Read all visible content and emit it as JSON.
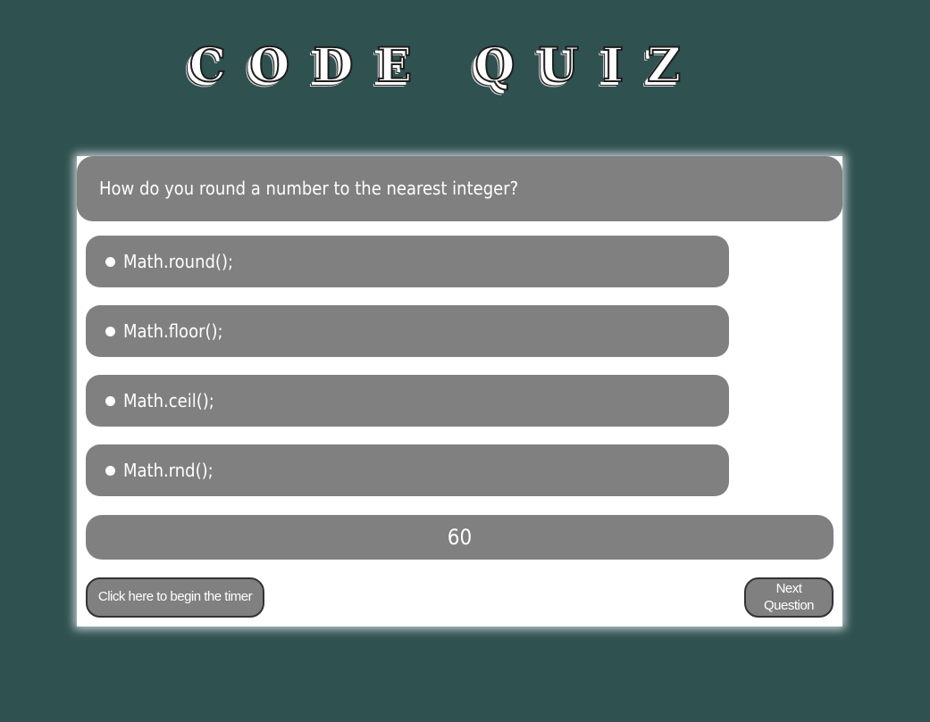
{
  "header": {
    "title": "CODE QUIZ"
  },
  "quiz": {
    "question": "How do you round a number to the nearest integer?",
    "answers": [
      "Math.round();",
      "Math.floor();",
      "Math.ceil();",
      "Math.rnd();"
    ],
    "timer_value": "60",
    "start_button_label": "Click here to begin the timer",
    "next_button_label": "Next Question"
  },
  "colors": {
    "background": "#2f5150",
    "card": "#ffffff",
    "panel": "#808080",
    "text": "#ffffff"
  }
}
